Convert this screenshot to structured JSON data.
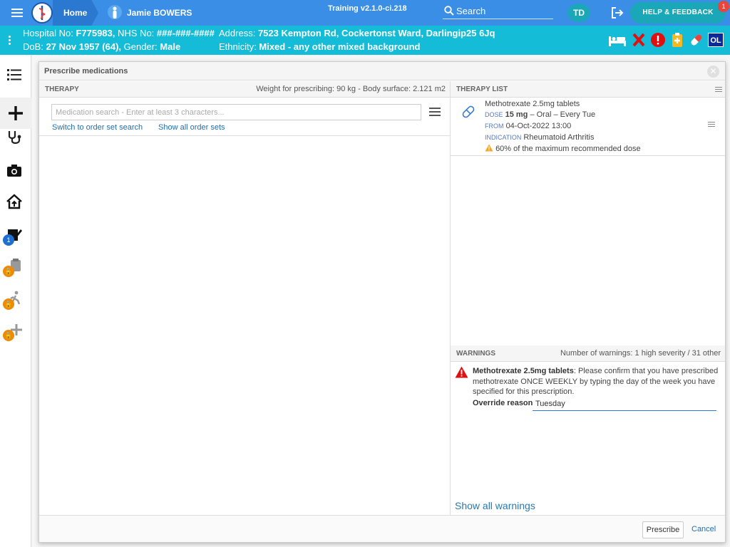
{
  "topbar": {
    "home_label": "Home",
    "patient_name": "Jamie BOWERS",
    "version": "Training v2.1.0-ci.218",
    "search_label": "Search",
    "user_initials": "TD",
    "help_label": "HELP & FEEDBACK",
    "help_badge": "1"
  },
  "banner": {
    "hospital_no_label": "Hospital No:",
    "hospital_no": "F775983,",
    "nhs_no_label": "NHS No:",
    "nhs_no": "###-###-####",
    "address_label": "Address:",
    "address": "7523 Kempton Rd, Cockertonst Ward, Darlingip25 6Jq",
    "dob_label": "DoB:",
    "dob": "27 Nov 1957 (64),",
    "gender_label": "Gender:",
    "gender": "Male",
    "ethnicity_label": "Ethnicity:",
    "ethnicity": "Mixed - any other mixed background",
    "ol_badge": "OL"
  },
  "nav": {
    "badge_tasks": "1"
  },
  "modal": {
    "title": "Prescribe medications",
    "therapy": {
      "heading": "THERAPY",
      "weight_info": "Weight for prescribing: 90 kg - Body surface: 2.121 m2",
      "search_placeholder": "Medication search - Enter at least 3 characters...",
      "link_order_set_search": "Switch to order set search",
      "link_show_order_sets": "Show all order sets"
    },
    "therapy_list": {
      "heading": "THERAPY LIST",
      "items": [
        {
          "name": "Methotrexate 2.5mg tablets",
          "dose_label": "DOSE",
          "dose": "15 mg",
          "dose_rest": "– Oral – Every Tue",
          "from_label": "FROM",
          "from": "04-Oct-2022 13:00",
          "indication_label": "INDICATION",
          "indication": "Rheumatoid Arthritis",
          "warning": "60% of the maximum recommended dose"
        }
      ]
    },
    "warnings": {
      "heading": "WARNINGS",
      "count_info": "Number of warnings: 1 high severity / 31 other",
      "items": [
        {
          "drug": "Methotrexate 2.5mg tablets",
          "message": ": Please confirm that you have prescribed methotrexate ONCE WEEKLY by typing the day of the week you have specified for this prescription.",
          "override_label": "Override reason",
          "override_value": "Tuesday"
        }
      ],
      "show_all": "Show all warnings"
    },
    "footer": {
      "prescribe": "Prescribe",
      "cancel": "Cancel"
    }
  },
  "colors": {
    "topbar": "#3a8ee6",
    "banner": "#14bcd8",
    "accent": "#1aa8b8",
    "danger": "#e8453c",
    "link": "#1e6fb0"
  }
}
